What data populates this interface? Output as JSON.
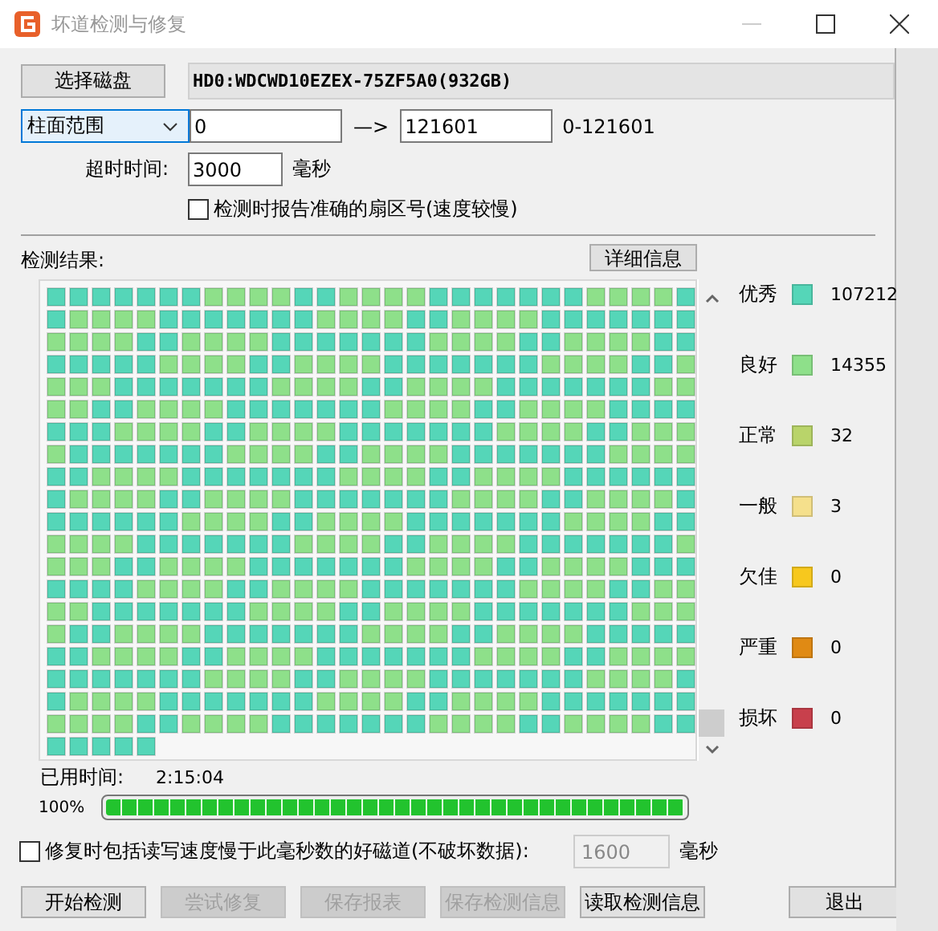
{
  "window": {
    "title": "坏道检测与修复"
  },
  "disk": {
    "button": "选择磁盘",
    "name": "HD0:WDCWD10EZEX-75ZF5A0(932GB)"
  },
  "range": {
    "mode": "柱面范围",
    "from": "0",
    "arrow": "—>",
    "to": "121601",
    "limits": "0-121601"
  },
  "timeout": {
    "label": "超时时间:",
    "value": "3000",
    "unit": "毫秒"
  },
  "report_sector": {
    "label": "检测时报告准确的扇区号(速度较慢)",
    "checked": false
  },
  "results": {
    "label": "检测结果:",
    "detail_button": "详细信息"
  },
  "grades": [
    {
      "label": "优秀",
      "color": "#55d6b8",
      "count": "107212"
    },
    {
      "label": "良好",
      "color": "#8ee08a",
      "count": "14355"
    },
    {
      "label": "正常",
      "color": "#b9d46a",
      "count": "32"
    },
    {
      "label": "一般",
      "color": "#f5e08c",
      "count": "3"
    },
    {
      "label": "欠佳",
      "color": "#f7c81e",
      "count": "0"
    },
    {
      "label": "严重",
      "color": "#e08a14",
      "count": "0"
    },
    {
      "label": "损坏",
      "color": "#c8404c",
      "count": "0"
    }
  ],
  "elapsed": {
    "label": "已用时间:",
    "value": "2:15:04"
  },
  "progress": {
    "percent": "100%",
    "level": 1
  },
  "slow_repair": {
    "label": "修复时包括读写速度慢于此毫秒数的好磁道(不破坏数据):",
    "checked": false,
    "value": "1600",
    "disabled": true,
    "unit": "毫秒"
  },
  "buttons": [
    {
      "label": "开始检测",
      "disabled": false
    },
    {
      "label": "尝试修复",
      "disabled": true
    },
    {
      "label": "保存报表",
      "disabled": true
    },
    {
      "label": "保存检测信息",
      "disabled": true
    },
    {
      "label": "读取检测信息",
      "disabled": false
    },
    {
      "label": "退出",
      "disabled": false
    }
  ]
}
